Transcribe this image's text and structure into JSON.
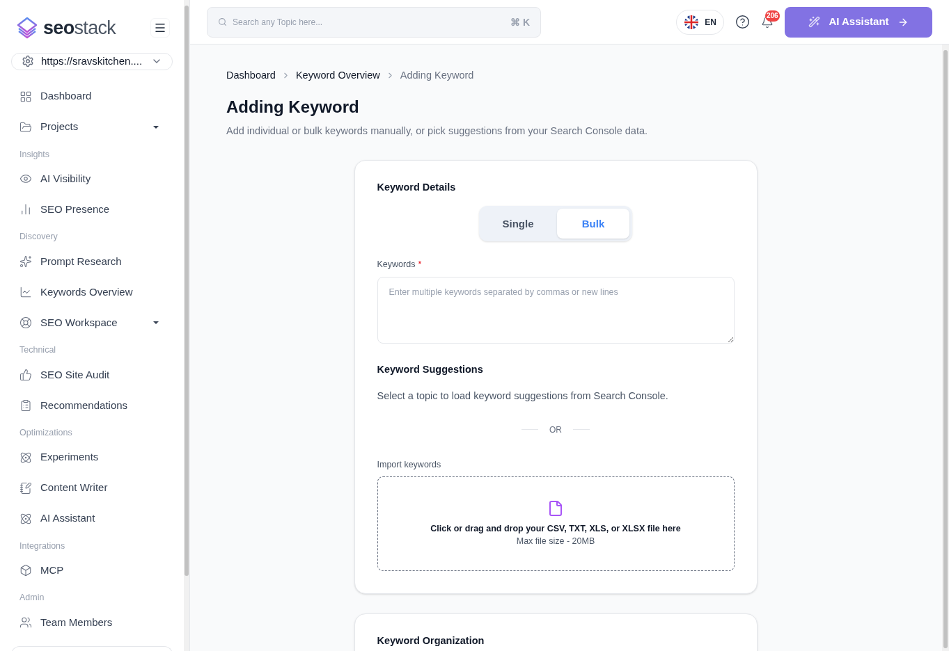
{
  "sidebar": {
    "logo": {
      "bold": "seo",
      "light": "stack"
    },
    "site_selector": "https://sravskitchen....",
    "sections": [
      {
        "items": [
          {
            "label": "Dashboard",
            "has_submenu": false
          },
          {
            "label": "Projects",
            "has_submenu": true
          }
        ]
      },
      {
        "heading": "Insights",
        "items": [
          {
            "label": "AI Visibility",
            "has_submenu": false
          },
          {
            "label": "SEO Presence",
            "has_submenu": false
          }
        ]
      },
      {
        "heading": "Discovery",
        "items": [
          {
            "label": "Prompt Research",
            "has_submenu": false
          },
          {
            "label": "Keywords Overview",
            "has_submenu": false
          },
          {
            "label": "SEO Workspace",
            "has_submenu": true
          }
        ]
      },
      {
        "heading": "Technical",
        "items": [
          {
            "label": "SEO Site Audit",
            "has_submenu": false
          },
          {
            "label": "Recommendations",
            "has_submenu": false
          }
        ]
      },
      {
        "heading": "Optimizations",
        "items": [
          {
            "label": "Experiments",
            "has_submenu": false
          },
          {
            "label": "Content Writer",
            "has_submenu": false
          },
          {
            "label": "AI Assistant",
            "has_submenu": false
          }
        ]
      },
      {
        "heading": "Integrations",
        "items": [
          {
            "label": "MCP",
            "has_submenu": false
          }
        ]
      },
      {
        "heading": "Admin",
        "items": [
          {
            "label": "Team Members",
            "has_submenu": false
          }
        ]
      }
    ]
  },
  "header": {
    "search": {
      "placeholder": "Search any Topic here...",
      "shortcut": "⌘ K"
    },
    "language": "EN",
    "notification_count": "206",
    "assistant_button": "AI Assistant"
  },
  "breadcrumb": [
    {
      "label": "Dashboard",
      "current": false
    },
    {
      "label": "Keyword Overview",
      "current": false
    },
    {
      "label": "Adding Keyword",
      "current": true
    }
  ],
  "title": "Adding Keyword",
  "subtitle": "Add individual or bulk keywords manually, or pick suggestions from your Search Console data.",
  "details_card": {
    "title": "Keyword Details",
    "mode_toggle": [
      {
        "label": "Single",
        "selected": false
      },
      {
        "label": "Bulk",
        "selected": true
      }
    ],
    "keywords_field": {
      "label": "Keywords",
      "required_mark": "*",
      "placeholder": "Enter multiple keywords separated by commas or new lines"
    },
    "suggestions": {
      "title": "Keyword Suggestions",
      "text": "Select a topic to load keyword suggestions from Search Console."
    },
    "divider": "OR",
    "import": {
      "label": "Import keywords",
      "drop_text": "Click or drag and drop your CSV, TXT, XLS, or XLSX file here",
      "max_size": "Max file size - 20MB"
    }
  },
  "organization_card": {
    "title": "Keyword Organization"
  }
}
